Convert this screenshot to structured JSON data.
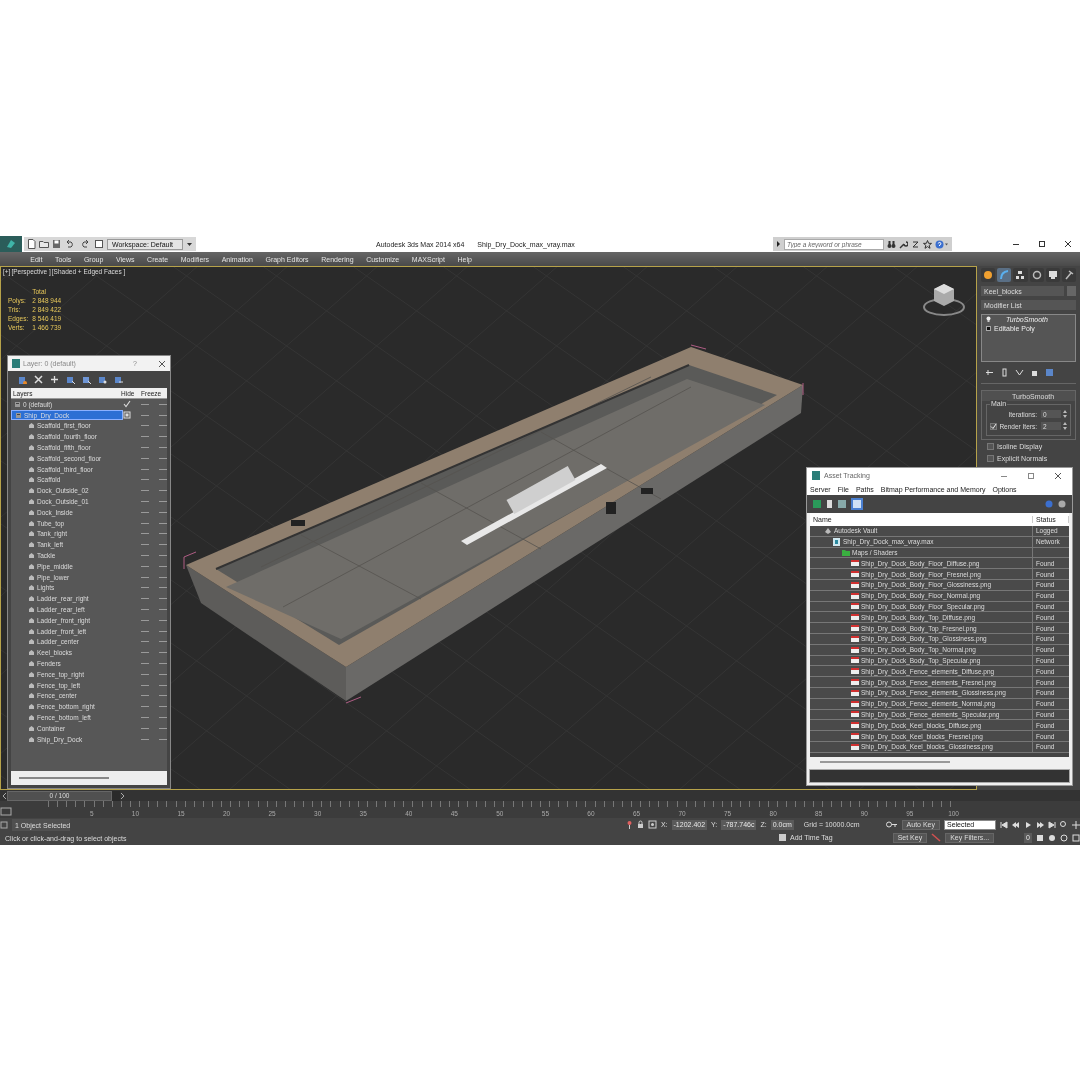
{
  "title_bar": {
    "workspace": "Workspace: Default",
    "app_title": "Autodesk 3ds Max  2014 x64",
    "file_name": "Ship_Dry_Dock_max_vray.max",
    "search": {
      "placeholder": "Type a keyword or phrase"
    }
  },
  "menu_bar": [
    "Edit",
    "Tools",
    "Group",
    "Views",
    "Create",
    "Modifiers",
    "Animation",
    "Graph Editors",
    "Rendering",
    "Customize",
    "MAXScript",
    "Help"
  ],
  "viewport": {
    "labels": [
      "[+]",
      "[Perspective ]",
      "[Shaded + Edged Faces ]"
    ],
    "stats": {
      "header": "Total",
      "rows": [
        {
          "label": "Polys:",
          "value": "2 848 944"
        },
        {
          "label": "Tris:",
          "value": "2 849 422"
        },
        {
          "label": "Edges:",
          "value": "8 546 419"
        },
        {
          "label": "Verts:",
          "value": "1 466 739"
        }
      ]
    }
  },
  "layer_window": {
    "title": "Layer: 0 (default)",
    "help": "?",
    "columns": [
      "Layers",
      "Hide",
      "Freeze"
    ],
    "layers": [
      {
        "name": "0 (default)",
        "current": true,
        "selected": false
      },
      {
        "name": "Ship_Dry_Dock",
        "current": false,
        "selected": true,
        "children": [
          {
            "name": "Scaffold_first_floor"
          },
          {
            "name": "Scaffold_fourth_floor"
          },
          {
            "name": "Scaffold_fifth_floor"
          },
          {
            "name": "Scaffold_second_floor"
          },
          {
            "name": "Scaffold_third_floor"
          },
          {
            "name": "Scaffold"
          },
          {
            "name": "Dock_Outside_02"
          },
          {
            "name": "Dock_Outside_01"
          },
          {
            "name": "Dock_Inside"
          },
          {
            "name": "Tube_top"
          },
          {
            "name": "Tank_right"
          },
          {
            "name": "Tank_left"
          },
          {
            "name": "Tackle"
          },
          {
            "name": "Pipe_middle"
          },
          {
            "name": "Pipe_lower"
          },
          {
            "name": "Lights"
          },
          {
            "name": "Ladder_rear_right"
          },
          {
            "name": "Ladder_rear_left"
          },
          {
            "name": "Ladder_front_right"
          },
          {
            "name": "Ladder_front_left"
          },
          {
            "name": "Ladder_center"
          },
          {
            "name": "Keel_blocks"
          },
          {
            "name": "Fenders"
          },
          {
            "name": "Fence_top_right"
          },
          {
            "name": "Fence_top_left"
          },
          {
            "name": "Fence_center"
          },
          {
            "name": "Fence_bottom_right"
          },
          {
            "name": "Fence_bottom_left"
          },
          {
            "name": "Container"
          },
          {
            "name": "Ship_Dry_Dock"
          }
        ]
      }
    ]
  },
  "command_panel": {
    "tabs": [
      {
        "kind": "create",
        "selected": false
      },
      {
        "kind": "modify",
        "selected": true
      },
      {
        "kind": "hierarchy",
        "selected": false
      },
      {
        "kind": "motion",
        "selected": false
      },
      {
        "kind": "display",
        "selected": false
      },
      {
        "kind": "utilities",
        "selected": false
      }
    ],
    "object_name": "Keel_blocks",
    "modifier_list": "Modifier List",
    "stack": [
      {
        "name": "TurboSmooth",
        "kind": "modifier"
      },
      {
        "name": "Editable Poly",
        "kind": "object"
      }
    ],
    "rollout": {
      "title": "TurboSmooth",
      "group": "Main",
      "iterations": {
        "label": "Iterations:",
        "value": "0"
      },
      "render_iters": {
        "label": "Render Iters:",
        "checked": true,
        "value": "2"
      },
      "options": [
        {
          "label": "Isoline Display",
          "checked": false
        },
        {
          "label": "Explicit Normals",
          "checked": false
        }
      ]
    }
  },
  "asset_tracking": {
    "title": "Asset Tracking",
    "menu": [
      "Server",
      "File",
      "Paths",
      "Bitmap Performance and Memory",
      "Options"
    ],
    "columns": [
      "Name",
      "Status"
    ],
    "tree": [
      {
        "name": "Autodesk Vault",
        "kind": "vault",
        "status": "Logged",
        "children": [
          {
            "name": "Ship_Dry_Dock_max_vray.max",
            "kind": "scene",
            "status": "Network",
            "children": [
              {
                "name": "Maps / Shaders",
                "kind": "folder",
                "children": [
                  {
                    "name": "Ship_Dry_Dock_Body_Floor_Diffuse.png",
                    "kind": "bitmap",
                    "status": "Found"
                  },
                  {
                    "name": "Ship_Dry_Dock_Body_Floor_Fresnel.png",
                    "kind": "bitmap",
                    "status": "Found"
                  },
                  {
                    "name": "Ship_Dry_Dock_Body_Floor_Glossiness.png",
                    "kind": "bitmap",
                    "status": "Found"
                  },
                  {
                    "name": "Ship_Dry_Dock_Body_Floor_Normal.png",
                    "kind": "bitmap",
                    "status": "Found"
                  },
                  {
                    "name": "Ship_Dry_Dock_Body_Floor_Specular.png",
                    "kind": "bitmap",
                    "status": "Found"
                  },
                  {
                    "name": "Ship_Dry_Dock_Body_Top_Diffuse.png",
                    "kind": "bitmap",
                    "status": "Found"
                  },
                  {
                    "name": "Ship_Dry_Dock_Body_Top_Fresnel.png",
                    "kind": "bitmap",
                    "status": "Found"
                  },
                  {
                    "name": "Ship_Dry_Dock_Body_Top_Glossiness.png",
                    "kind": "bitmap",
                    "status": "Found"
                  },
                  {
                    "name": "Ship_Dry_Dock_Body_Top_Normal.png",
                    "kind": "bitmap",
                    "status": "Found"
                  },
                  {
                    "name": "Ship_Dry_Dock_Body_Top_Specular.png",
                    "kind": "bitmap",
                    "status": "Found"
                  },
                  {
                    "name": "Ship_Dry_Dock_Fence_elements_Diffuse.png",
                    "kind": "bitmap",
                    "status": "Found"
                  },
                  {
                    "name": "Ship_Dry_Dock_Fence_elements_Fresnel.png",
                    "kind": "bitmap",
                    "status": "Found"
                  },
                  {
                    "name": "Ship_Dry_Dock_Fence_elements_Glossiness.png",
                    "kind": "bitmap",
                    "status": "Found"
                  },
                  {
                    "name": "Ship_Dry_Dock_Fence_elements_Normal.png",
                    "kind": "bitmap",
                    "status": "Found"
                  },
                  {
                    "name": "Ship_Dry_Dock_Fence_elements_Specular.png",
                    "kind": "bitmap",
                    "status": "Found"
                  },
                  {
                    "name": "Ship_Dry_Dock_Keel_blocks_Diffuse.png",
                    "kind": "bitmap",
                    "status": "Found"
                  },
                  {
                    "name": "Ship_Dry_Dock_Keel_blocks_Fresnel.png",
                    "kind": "bitmap",
                    "status": "Found"
                  },
                  {
                    "name": "Ship_Dry_Dock_Keel_blocks_Glossiness.png",
                    "kind": "bitmap",
                    "status": "Found"
                  }
                ]
              }
            ]
          }
        ]
      }
    ]
  },
  "time_slider": {
    "label": "0 / 100",
    "level": 0,
    "ticks": [
      "5",
      "10",
      "15",
      "20",
      "25",
      "30",
      "35",
      "40",
      "45",
      "50",
      "55",
      "60",
      "65",
      "70",
      "75",
      "80",
      "85",
      "90",
      "95",
      "100"
    ]
  },
  "status_bar": {
    "selection": "1 Object Selected",
    "prompt": "Click or click-and-drag to select objects",
    "x": {
      "label": "X:",
      "value": "-1202.402"
    },
    "y": {
      "label": "Y:",
      "value": "-787.746c"
    },
    "z": {
      "label": "Z:",
      "value": "0.0cm"
    },
    "grid": "Grid = 10000.0cm",
    "time_tag": "Add Time Tag",
    "auto_key": "Auto Key",
    "set_key": "Set Key",
    "key_mode": "Selected",
    "key_filters": "Key Filters...",
    "frame": "0"
  }
}
